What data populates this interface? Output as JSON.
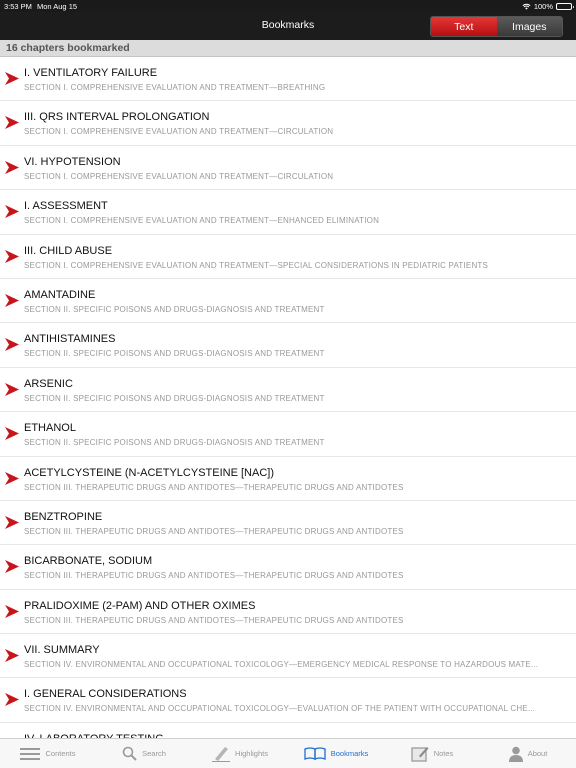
{
  "status_bar": {
    "time": "3:53 PM",
    "date": "Mon Aug 15",
    "battery": "100%"
  },
  "nav": {
    "title": "Bookmarks",
    "segments": [
      {
        "label": "Text",
        "active": true
      },
      {
        "label": "Images",
        "active": false
      }
    ]
  },
  "header": {
    "count_text": "16 chapters bookmarked"
  },
  "bookmarks": [
    {
      "title": "I. VENTILATORY FAILURE",
      "subtitle": "SECTION I. COMPREHENSIVE EVALUATION AND TREATMENT—BREATHING"
    },
    {
      "title": "III. QRS INTERVAL PROLONGATION",
      "subtitle": "SECTION I. COMPREHENSIVE EVALUATION AND TREATMENT—CIRCULATION"
    },
    {
      "title": "VI. HYPOTENSION",
      "subtitle": "SECTION I. COMPREHENSIVE EVALUATION AND TREATMENT—CIRCULATION"
    },
    {
      "title": "I. ASSESSMENT",
      "subtitle": "SECTION I. COMPREHENSIVE EVALUATION AND TREATMENT—ENHANCED ELIMINATION"
    },
    {
      "title": "III. CHILD ABUSE",
      "subtitle": "SECTION I. COMPREHENSIVE EVALUATION AND TREATMENT—SPECIAL CONSIDERATIONS IN PEDIATRIC PATIENTS"
    },
    {
      "title": "AMANTADINE",
      "subtitle": "SECTION II. SPECIFIC POISONS AND DRUGS-DIAGNOSIS AND TREATMENT"
    },
    {
      "title": "ANTIHISTAMINES",
      "subtitle": "SECTION II. SPECIFIC POISONS AND DRUGS-DIAGNOSIS AND TREATMENT"
    },
    {
      "title": "ARSENIC",
      "subtitle": "SECTION II. SPECIFIC POISONS AND DRUGS-DIAGNOSIS AND TREATMENT"
    },
    {
      "title": "ETHANOL",
      "subtitle": "SECTION II. SPECIFIC POISONS AND DRUGS-DIAGNOSIS AND TREATMENT"
    },
    {
      "title": "ACETYLCYSTEINE (N-ACETYLCYSTEINE [NAC])",
      "subtitle": "SECTION III. THERAPEUTIC DRUGS AND ANTIDOTES—THERAPEUTIC DRUGS AND ANTIDOTES"
    },
    {
      "title": "BENZTROPINE",
      "subtitle": "SECTION III. THERAPEUTIC DRUGS AND ANTIDOTES—THERAPEUTIC DRUGS AND ANTIDOTES"
    },
    {
      "title": "BICARBONATE, SODIUM",
      "subtitle": "SECTION III. THERAPEUTIC DRUGS AND ANTIDOTES—THERAPEUTIC DRUGS AND ANTIDOTES"
    },
    {
      "title": "PRALIDOXIME (2-PAM) AND OTHER OXIMES",
      "subtitle": "SECTION III. THERAPEUTIC DRUGS AND ANTIDOTES—THERAPEUTIC DRUGS AND ANTIDOTES"
    },
    {
      "title": "VII. SUMMARY",
      "subtitle": "SECTION IV. ENVIRONMENTAL AND OCCUPATIONAL TOXICOLOGY—EMERGENCY MEDICAL RESPONSE TO HAZARDOUS MATE..."
    },
    {
      "title": "I. GENERAL CONSIDERATIONS",
      "subtitle": "SECTION IV. ENVIRONMENTAL AND OCCUPATIONAL TOXICOLOGY—EVALUATION OF THE PATIENT WITH OCCUPATIONAL CHE..."
    },
    {
      "title": "IV. LABORATORY TESTING",
      "subtitle": ""
    }
  ],
  "tabbar": {
    "tabs": [
      {
        "label": "Contents",
        "icon": "list-icon",
        "active": false
      },
      {
        "label": "Search",
        "icon": "search-icon",
        "active": false
      },
      {
        "label": "Highlights",
        "icon": "highlighter-icon",
        "active": false
      },
      {
        "label": "Bookmarks",
        "icon": "book-icon",
        "active": true
      },
      {
        "label": "Notes",
        "icon": "notes-icon",
        "active": false
      },
      {
        "label": "About",
        "icon": "person-icon",
        "active": false
      }
    ]
  },
  "colors": {
    "accent": "#1f6fd1",
    "bookmark_red": "#c8141b",
    "nav_bg": "#1c1c1c"
  }
}
